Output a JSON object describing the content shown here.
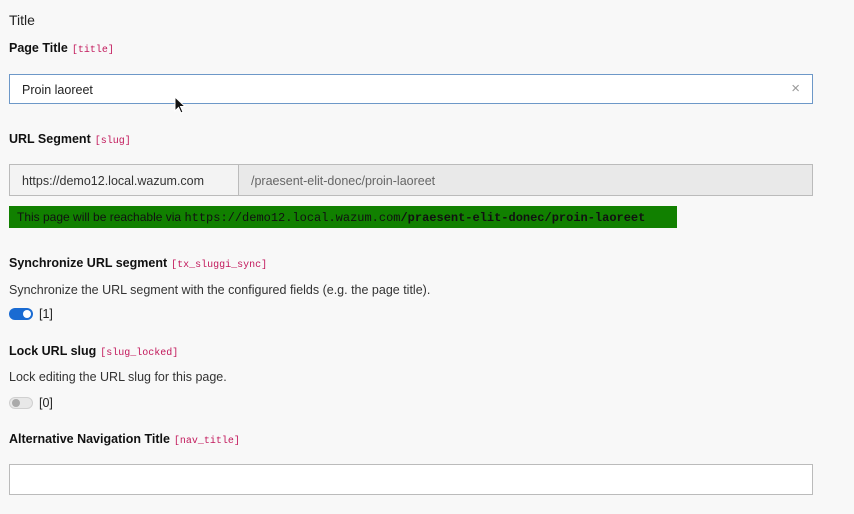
{
  "section": {
    "title": "Title"
  },
  "fields": {
    "page_title": {
      "label": "Page Title",
      "code": "[title]",
      "value": "Proin laoreet",
      "clear_glyph": "×"
    },
    "url_segment": {
      "label": "URL Segment",
      "code": "[slug]",
      "prefix": "https://demo12.local.wazum.com",
      "value": "/praesent-elit-donec/proin-laoreet",
      "reach_prefix": "This page will be reachable via ",
      "reach_host": "https://demo12.local.wazum.com",
      "reach_path": "/praesent-elit-donec/proin-laoreet",
      "reach_bg_color": "#118000"
    },
    "sync": {
      "label": "Synchronize URL segment",
      "code": "[tx_sluggi_sync]",
      "description": "Synchronize the URL segment with the configured fields (e.g. the page title).",
      "state": "on",
      "value_text": "[1]",
      "accent_color": "#1a6bd2"
    },
    "lock": {
      "label": "Lock URL slug",
      "code": "[slug_locked]",
      "description": "Lock editing the URL slug for this page.",
      "state": "off",
      "value_text": "[0]"
    },
    "nav_title": {
      "label": "Alternative Navigation Title",
      "code": "[nav_title]",
      "value": ""
    }
  },
  "colors": {
    "code_tag": "#c2185b",
    "focus_border": "#6d98c8"
  },
  "cursor": {
    "icon": "mouse-pointer-icon"
  }
}
